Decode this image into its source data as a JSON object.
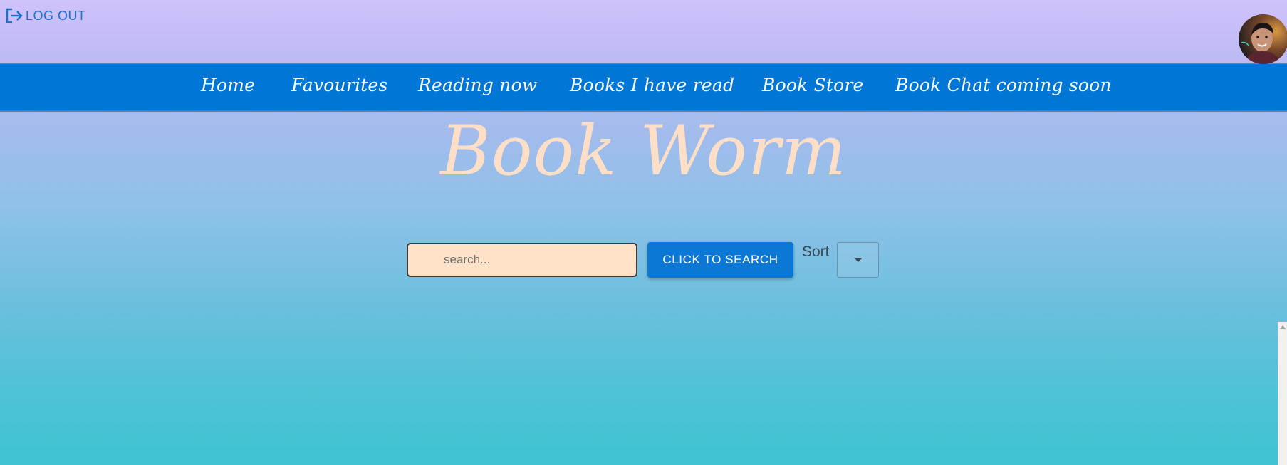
{
  "header": {
    "logout_label": "LOG OUT",
    "logout_icon": "logout-icon",
    "avatar_icon": "user-avatar"
  },
  "nav": {
    "items": [
      {
        "label": "Home"
      },
      {
        "label": "Favourites"
      },
      {
        "label": "Reading now"
      },
      {
        "label": "Books I have read"
      },
      {
        "label": "Book Store"
      },
      {
        "label": "Book Chat coming soon"
      }
    ]
  },
  "brand": {
    "title": "Book Worm"
  },
  "search": {
    "placeholder": "search...",
    "value": "",
    "button_label": "CLICK TO SEARCH"
  },
  "sort": {
    "label": "Sort",
    "selected": ""
  },
  "colors": {
    "nav_bg": "#0077d6",
    "brand_text": "#fddec6",
    "search_bg": "#ffe2c7",
    "button_bg": "#0a78d4",
    "logout_text": "#1a72cf"
  }
}
